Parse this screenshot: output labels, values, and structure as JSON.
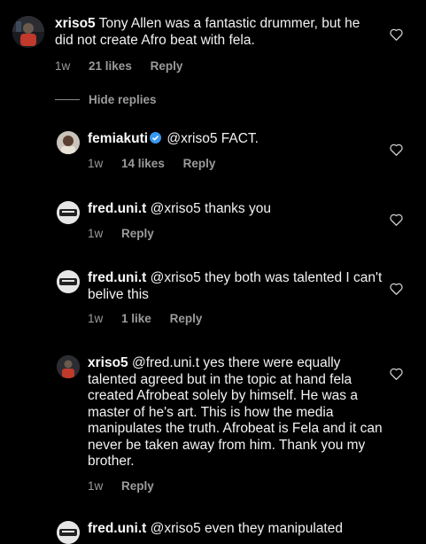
{
  "comments": [
    {
      "username": "xriso5",
      "text": "Tony Allen was a fantastic drummer, but he did not create Afro beat with fela.",
      "time": "1w",
      "likes": "21 likes",
      "reply": "Reply"
    }
  ],
  "hide_replies": "Hide replies",
  "replies": [
    {
      "username": "femiakuti",
      "text": "@xriso5 FACT.",
      "time": "1w",
      "likes": "14 likes",
      "reply": "Reply"
    },
    {
      "username": "fred.uni.t",
      "text": "@xriso5 thanks you",
      "time": "1w",
      "likes": "",
      "reply": "Reply"
    },
    {
      "username": "fred.uni.t",
      "text": "@xriso5 they both was talented I can't belive this",
      "time": "1w",
      "likes": "1 like",
      "reply": "Reply"
    },
    {
      "username": "xriso5",
      "text": "@fred.uni.t yes there were equally talented agreed but in the topic at hand fela created Afrobeat solely by himself. He was a master of he's art. This is how the media manipulates the truth. Afrobeat is Fela and it can never be taken away from him. Thank you my brother.",
      "time": "1w",
      "likes": "",
      "reply": "Reply"
    },
    {
      "username": "fred.uni.t",
      "text": "@xriso5 even they manipulated",
      "time": "",
      "likes": "",
      "reply": ""
    }
  ]
}
